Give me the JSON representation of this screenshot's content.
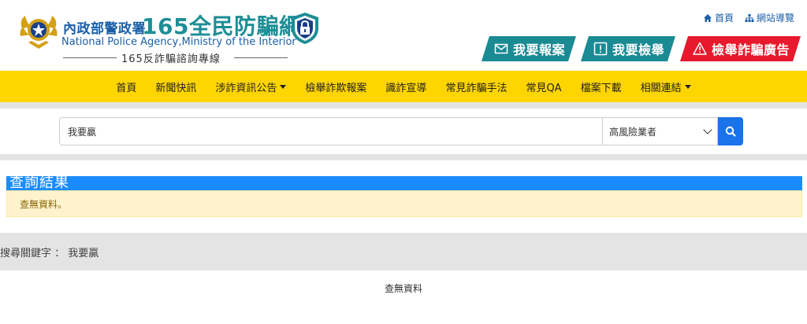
{
  "header": {
    "agency_cn": "內政部警政署",
    "site_title": "165全民防騙網",
    "agency_en": "National Police Agency,Ministry of the Interior",
    "hotline": "165反詐騙諮詢專線",
    "toplinks": [
      {
        "label": "首頁",
        "icon": "home-icon"
      },
      {
        "label": "網站導覽",
        "icon": "sitemap-icon"
      }
    ],
    "actions": {
      "report": "我要報案",
      "inform": "我要檢舉",
      "ad_report": "檢舉詐騙廣告"
    }
  },
  "nav": {
    "items": [
      {
        "label": "首頁",
        "dropdown": false
      },
      {
        "label": "新聞快訊",
        "dropdown": false
      },
      {
        "label": "涉詐資訊公告",
        "dropdown": true
      },
      {
        "label": "檢舉詐欺報案",
        "dropdown": false
      },
      {
        "label": "識詐宣導",
        "dropdown": false
      },
      {
        "label": "常見詐騙手法",
        "dropdown": false
      },
      {
        "label": "常見QA",
        "dropdown": false
      },
      {
        "label": "檔案下載",
        "dropdown": false
      },
      {
        "label": "相關連結",
        "dropdown": true
      }
    ]
  },
  "search": {
    "value": "我要贏",
    "category": "高風險業者"
  },
  "results": {
    "title": "查詢結果",
    "alert": "查無資料。"
  },
  "keyword": {
    "text": "搜尋關鍵字 ： 我要贏"
  },
  "nodata": "查無資料",
  "colors": {
    "nav_bg": "#ffd500",
    "teal": "#1a8a93",
    "red": "#e8192c",
    "blue": "#1a8cff"
  }
}
